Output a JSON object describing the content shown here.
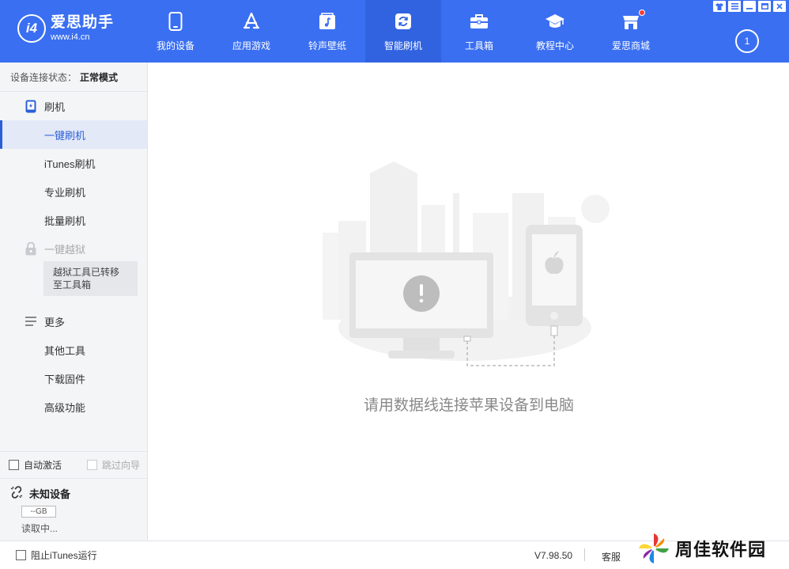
{
  "app": {
    "name": "爱思助手",
    "url": "www.i4.cn",
    "logo_mark": "i4"
  },
  "nav": [
    {
      "label": "我的设备",
      "icon": "phone-icon"
    },
    {
      "label": "应用游戏",
      "icon": "app-store-icon"
    },
    {
      "label": "铃声壁纸",
      "icon": "music-icon"
    },
    {
      "label": "智能刷机",
      "icon": "refresh-icon",
      "active": true
    },
    {
      "label": "工具箱",
      "icon": "toolbox-icon"
    },
    {
      "label": "教程中心",
      "icon": "graduation-cap-icon"
    },
    {
      "label": "爱思商城",
      "icon": "store-icon",
      "badge": true
    }
  ],
  "download_count": "1",
  "window_controls": [
    "shirt-icon",
    "menu-icon",
    "minimize-icon",
    "maximize-icon",
    "close-icon"
  ],
  "sidebar": {
    "status_label": "设备连接状态：",
    "status_value": "正常模式",
    "flash": {
      "label": "刷机",
      "items": [
        "一键刷机",
        "iTunes刷机",
        "专业刷机",
        "批量刷机"
      ]
    },
    "jailbreak": {
      "label": "一键越狱",
      "tip": "越狱工具已转移至工具箱"
    },
    "more": {
      "label": "更多",
      "items": [
        "其他工具",
        "下载固件",
        "高级功能"
      ]
    },
    "auto_activate": "自动激活",
    "skip_guide": "跳过向导",
    "device": {
      "name": "未知设备",
      "capacity": "--GB",
      "status": "读取中..."
    }
  },
  "main": {
    "message": "请用数据线连接苹果设备到电脑"
  },
  "footer": {
    "block_itunes": "阻止iTunes运行",
    "version": "V7.98.50",
    "service": "客服"
  },
  "watermark": "周佳软件园",
  "colors": {
    "brand_blue": "#3a6ff2",
    "active_blue": "#2a5fd8",
    "badge_red": "#ff3b30"
  }
}
